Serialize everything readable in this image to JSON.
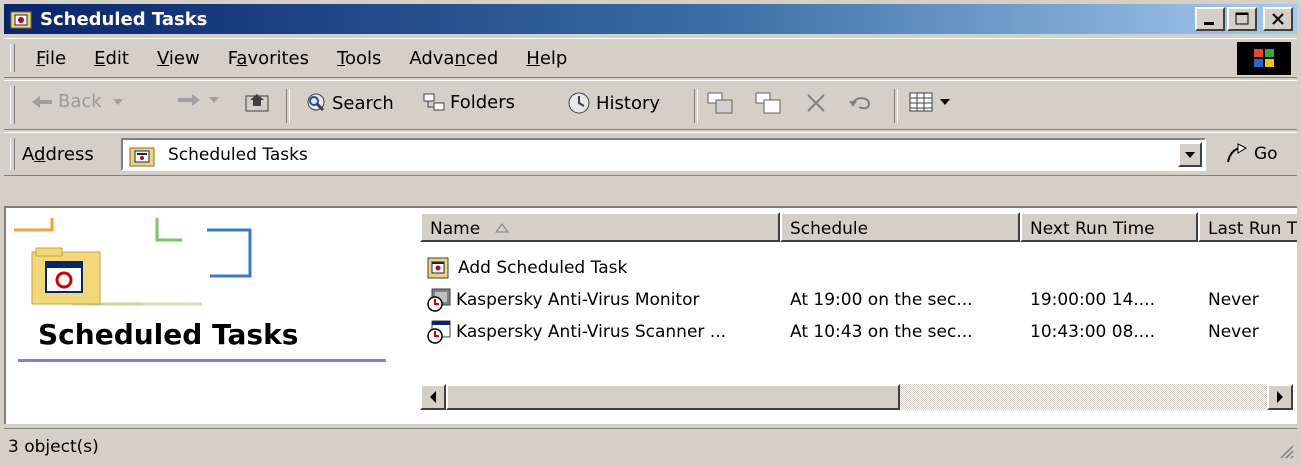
{
  "window": {
    "title": "Scheduled Tasks"
  },
  "menu": [
    {
      "pre": "",
      "u": "F",
      "post": "ile"
    },
    {
      "pre": "",
      "u": "E",
      "post": "dit"
    },
    {
      "pre": "",
      "u": "V",
      "post": "iew"
    },
    {
      "pre": "F",
      "u": "a",
      "post": "vorites"
    },
    {
      "pre": "",
      "u": "T",
      "post": "ools"
    },
    {
      "pre": "Adva",
      "u": "n",
      "post": "ced"
    },
    {
      "pre": "",
      "u": "H",
      "post": "elp"
    }
  ],
  "toolbar": {
    "back": "Back",
    "search": "Search",
    "folders": "Folders",
    "history": "History"
  },
  "address": {
    "label_pre": "A",
    "label_u": "d",
    "label_post": "dress",
    "value": "Scheduled Tasks",
    "go": "Go"
  },
  "left_pane": {
    "title": "Scheduled Tasks"
  },
  "columns": [
    "Name",
    "Schedule",
    "Next Run Time",
    "Last Run T"
  ],
  "rows": [
    {
      "name": "Add Scheduled Task",
      "schedule": "",
      "next": "",
      "last": ""
    },
    {
      "name": "Kaspersky Anti-Virus Monitor",
      "schedule": "At 19:00 on the sec...",
      "next": "19:00:00  14....",
      "last": "Never"
    },
    {
      "name": "Kaspersky Anti-Virus Scanner ...",
      "schedule": "At 10:43 on the sec...",
      "next": "10:43:00  08....",
      "last": "Never"
    }
  ],
  "status": {
    "text": "3 object(s)"
  },
  "colors": {
    "title_start": "#0a246a",
    "title_end": "#a6caf0",
    "face": "#d4d0c8",
    "accent_line": "#6f8cc8"
  }
}
